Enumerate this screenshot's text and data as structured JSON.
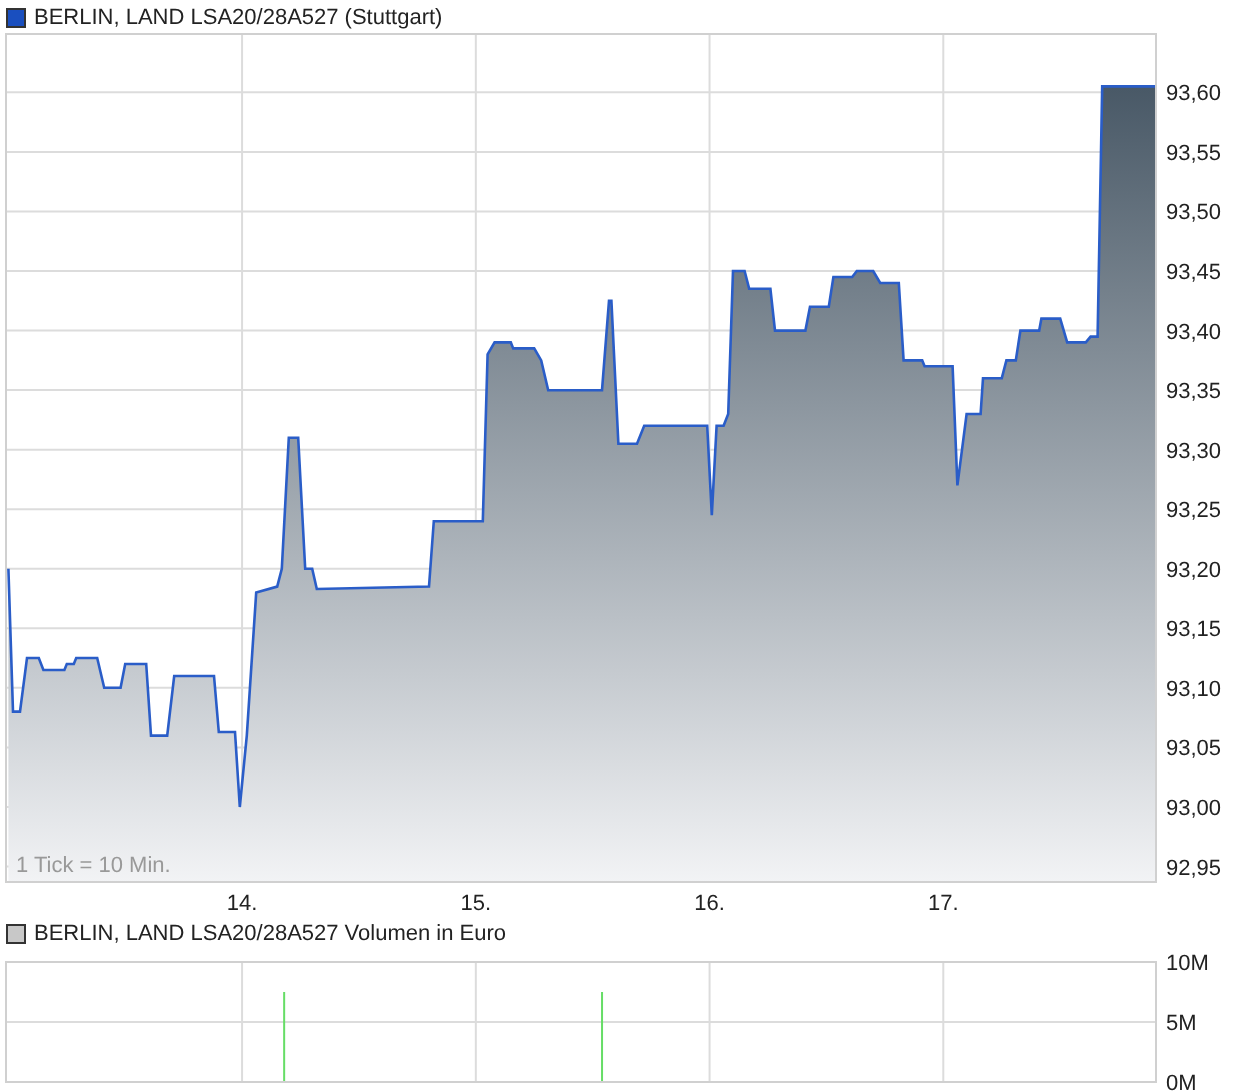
{
  "price_chart": {
    "note": "1 Tick = 10 Min.",
    "chart_data": {
      "type": "area",
      "grid": true,
      "x": [
        13.0,
        13.02,
        13.05,
        13.08,
        13.13,
        13.15,
        13.24,
        13.25,
        13.28,
        13.29,
        13.38,
        13.41,
        13.48,
        13.5,
        13.59,
        13.61,
        13.68,
        13.71,
        13.88,
        13.9,
        13.97,
        13.99,
        14.02,
        14.06,
        14.15,
        14.17,
        14.2,
        14.24,
        14.27,
        14.3,
        14.32,
        14.8,
        14.82,
        15.03,
        15.05,
        15.08,
        15.15,
        15.16,
        15.25,
        15.28,
        15.31,
        15.54,
        15.57,
        15.58,
        15.61,
        15.69,
        15.72,
        15.99,
        16.01,
        16.03,
        16.06,
        16.08,
        16.1,
        16.15,
        16.17,
        16.26,
        16.28,
        16.41,
        16.43,
        16.51,
        16.53,
        16.61,
        16.63,
        16.7,
        16.73,
        16.81,
        16.83,
        16.91,
        16.92,
        17.04,
        17.06,
        17.1,
        17.16,
        17.17,
        17.25,
        17.27,
        17.31,
        17.33,
        17.41,
        17.42,
        17.5,
        17.53,
        17.61,
        17.63,
        17.66,
        17.68,
        17.91
      ],
      "series": [
        {
          "name": "BERLIN, LAND LSA20/28A527 (Stuttgart)",
          "color": "#2a5dc8",
          "values": [
            93.2,
            93.08,
            93.08,
            93.125,
            93.125,
            93.115,
            93.115,
            93.12,
            93.12,
            93.125,
            93.125,
            93.1,
            93.1,
            93.12,
            93.12,
            93.06,
            93.06,
            93.11,
            93.11,
            93.063,
            93.063,
            93.0,
            93.06,
            93.18,
            93.185,
            93.2,
            93.31,
            93.31,
            93.2,
            93.2,
            93.183,
            93.185,
            93.24,
            93.24,
            93.38,
            93.39,
            93.39,
            93.385,
            93.385,
            93.375,
            93.35,
            93.35,
            93.425,
            93.425,
            93.305,
            93.305,
            93.32,
            93.32,
            93.245,
            93.32,
            93.32,
            93.33,
            93.45,
            93.45,
            93.435,
            93.435,
            93.4,
            93.4,
            93.42,
            93.42,
            93.445,
            93.445,
            93.45,
            93.45,
            93.44,
            93.44,
            93.375,
            93.375,
            93.37,
            93.37,
            93.27,
            93.33,
            93.33,
            93.36,
            93.36,
            93.375,
            93.375,
            93.4,
            93.4,
            93.41,
            93.41,
            93.39,
            93.39,
            93.395,
            93.395,
            93.605,
            93.605
          ]
        }
      ],
      "xlim": [
        12.99,
        17.91
      ],
      "ylim": [
        92.937,
        93.649
      ],
      "xticks": [
        {
          "value": 14,
          "label": "14."
        },
        {
          "value": 15,
          "label": "15."
        },
        {
          "value": 16,
          "label": "16."
        },
        {
          "value": 17,
          "label": "17."
        }
      ],
      "yticks": [
        {
          "value": 92.95,
          "label": "92,95"
        },
        {
          "value": 93.0,
          "label": "93,00"
        },
        {
          "value": 93.05,
          "label": "93,05"
        },
        {
          "value": 93.1,
          "label": "93,10"
        },
        {
          "value": 93.15,
          "label": "93,15"
        },
        {
          "value": 93.2,
          "label": "93,20"
        },
        {
          "value": 93.25,
          "label": "93,25"
        },
        {
          "value": 93.3,
          "label": "93,30"
        },
        {
          "value": 93.35,
          "label": "93,35"
        },
        {
          "value": 93.4,
          "label": "93,40"
        },
        {
          "value": 93.45,
          "label": "93,45"
        },
        {
          "value": 93.5,
          "label": "93,50"
        },
        {
          "value": 93.55,
          "label": "93,55"
        },
        {
          "value": 93.6,
          "label": "93,60"
        }
      ]
    }
  },
  "volume_chart": {
    "chart_data": {
      "type": "bar",
      "grid": true,
      "x": [
        14.18,
        15.54
      ],
      "series": [
        {
          "name": "BERLIN, LAND LSA20/28A527 Volumen in Euro",
          "color": "#66dd66",
          "values": [
            7500000,
            7500000
          ]
        }
      ],
      "xlim": [
        12.99,
        17.91
      ],
      "ylim": [
        0,
        10000000
      ],
      "yticks": [
        {
          "value": 0,
          "label": "0M"
        },
        {
          "value": 5000000,
          "label": "5M"
        },
        {
          "value": 10000000,
          "label": "10M"
        }
      ]
    }
  }
}
